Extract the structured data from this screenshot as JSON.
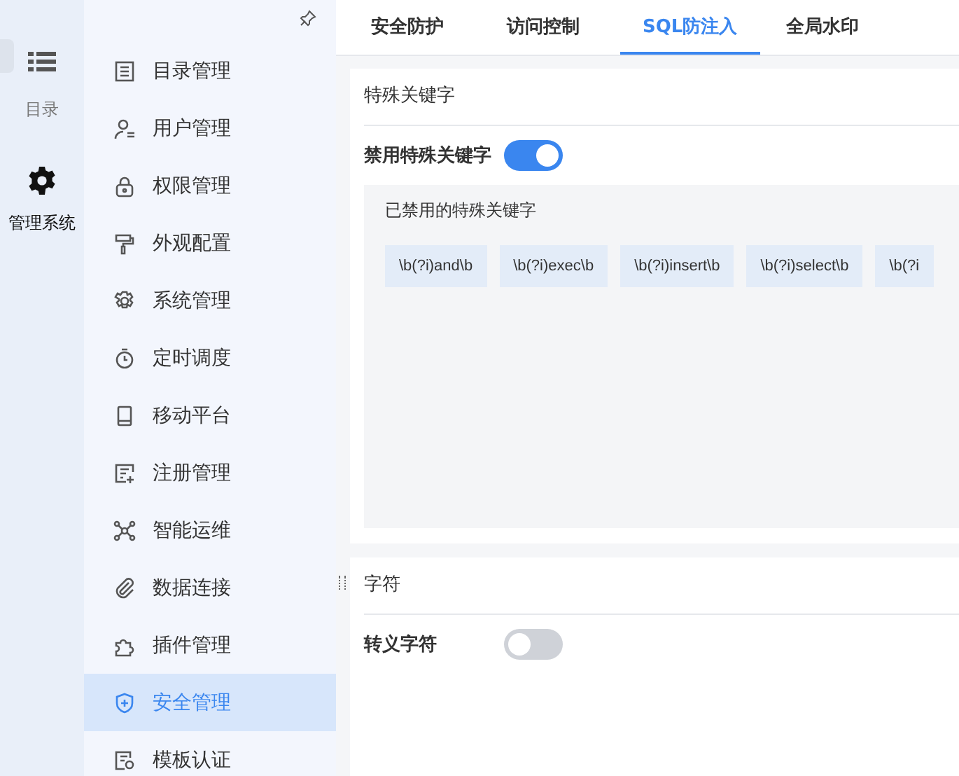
{
  "rail": {
    "items": [
      {
        "label": "目录",
        "kind": "list",
        "selected": false
      },
      {
        "label": "管理系统",
        "kind": "gear",
        "selected": true
      }
    ]
  },
  "sidebar": {
    "items": [
      {
        "label": "目录管理",
        "selected": false
      },
      {
        "label": "用户管理",
        "selected": false
      },
      {
        "label": "权限管理",
        "selected": false
      },
      {
        "label": "外观配置",
        "selected": false
      },
      {
        "label": "系统管理",
        "selected": false
      },
      {
        "label": "定时调度",
        "selected": false
      },
      {
        "label": "移动平台",
        "selected": false
      },
      {
        "label": "注册管理",
        "selected": false
      },
      {
        "label": "智能运维",
        "selected": false
      },
      {
        "label": "数据连接",
        "selected": false
      },
      {
        "label": "插件管理",
        "selected": false
      },
      {
        "label": "安全管理",
        "selected": true
      },
      {
        "label": "模板认证",
        "selected": false
      }
    ]
  },
  "tabs": [
    {
      "label": "安全防护",
      "selected": false
    },
    {
      "label": "访问控制",
      "selected": false
    },
    {
      "label": "SQL防注入",
      "selected": true
    },
    {
      "label": "全局水印",
      "selected": false
    }
  ],
  "sections": [
    {
      "title": "特殊关键字",
      "toggle": {
        "label": "禁用特殊关键字",
        "on": true
      },
      "panel": {
        "title": "已禁用的特殊关键字",
        "tags": [
          "\\b(?i)and\\b",
          "\\b(?i)exec\\b",
          "\\b(?i)insert\\b",
          "\\b(?i)select\\b",
          "\\b(?i"
        ]
      }
    },
    {
      "title": "字符",
      "toggle": {
        "label": "转义字符",
        "on": false
      }
    }
  ]
}
